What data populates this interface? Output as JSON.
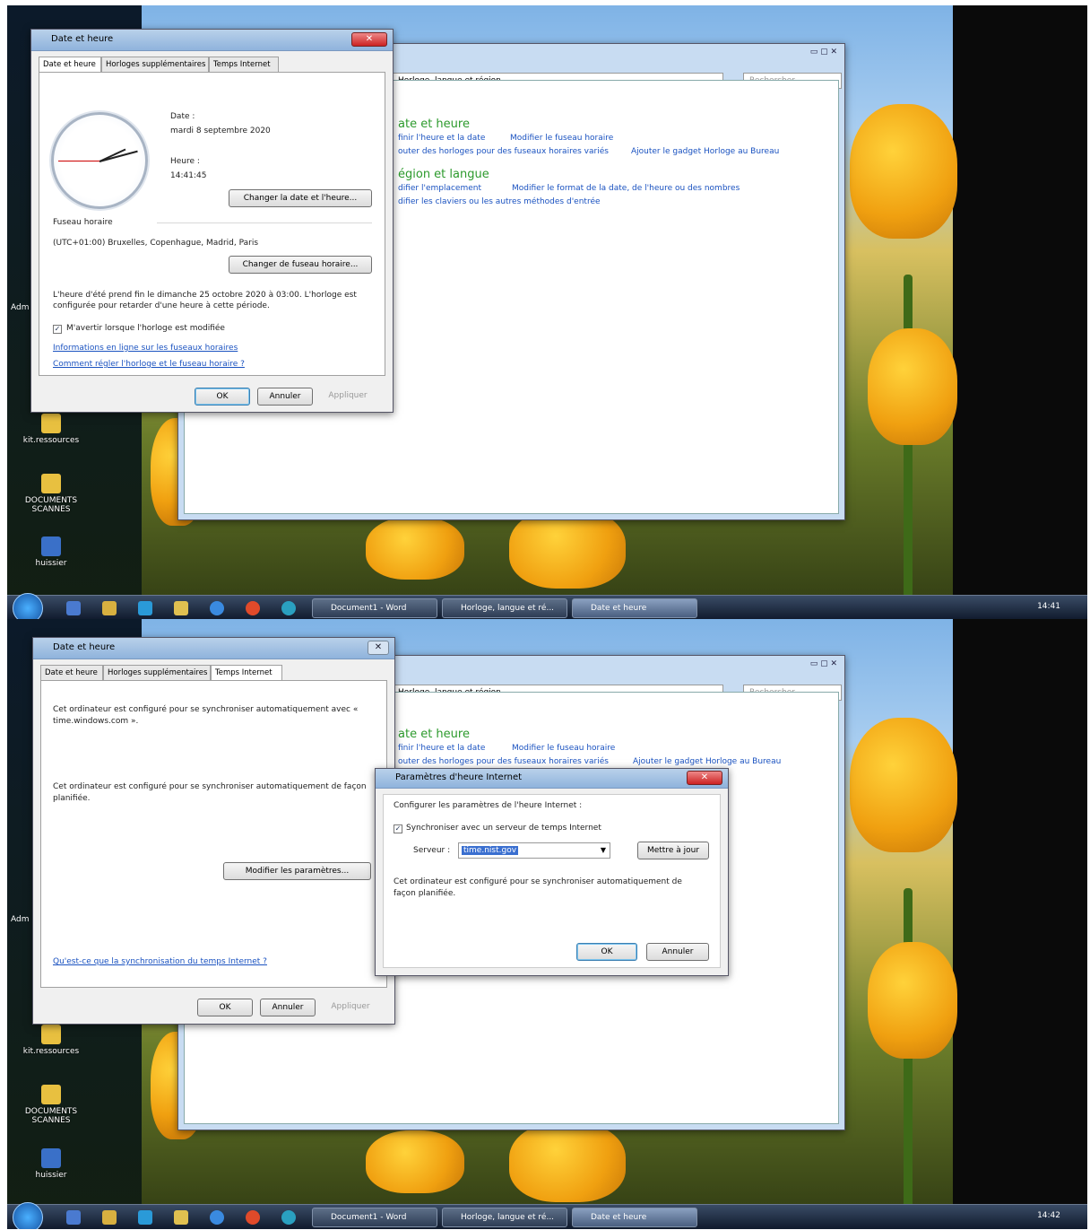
{
  "desktop": {
    "icons": [
      {
        "label": "kit.ressources"
      },
      {
        "label": "DOCUMENTS SCANNES"
      },
      {
        "label": "huissier"
      }
    ],
    "left_label": "Adm"
  },
  "taskbar": {
    "buttons": [
      "Document1 - Word",
      "Horloge, langue et ré...",
      "Date et heure"
    ],
    "time1": "14:41",
    "time2": "14:42"
  },
  "control_panel": {
    "address": "Horloge, langue et région",
    "search_placeholder": "Rechercher",
    "section1_title": "ate et heure",
    "section1_links": [
      "finir l'heure et la date",
      "Modifier le fuseau horaire",
      "outer des horloges pour des fuseaux horaires variés",
      "Ajouter le gadget Horloge au Bureau"
    ],
    "section2_title": "égion et langue",
    "section2_links": [
      "difier l'emplacement",
      "Modifier le format de la date, de l'heure ou des nombres",
      "difier les claviers ou les autres méthodes d'entrée"
    ]
  },
  "dialog1": {
    "title": "Date et heure",
    "tabs": [
      "Date et heure",
      "Horloges supplémentaires",
      "Temps Internet"
    ],
    "date_label": "Date :",
    "date_value": "mardi 8 septembre 2020",
    "time_label": "Heure :",
    "time_value": "14:41:45",
    "change_date_button": "Changer la date et l'heure...",
    "timezone_label": "Fuseau horaire",
    "timezone_value": "(UTC+01:00) Bruxelles, Copenhague, Madrid, Paris",
    "change_tz_button": "Changer de fuseau horaire...",
    "dst_note": "L'heure d'été prend fin le dimanche 25 octobre 2020 à 03:00. L'horloge est configurée pour retarder d'une heure à cette période.",
    "notify_checkbox": "M'avertir lorsque l'horloge est modifiée",
    "link1": "Informations en ligne sur les fuseaux horaires",
    "link2": "Comment régler l'horloge et le fuseau horaire ?",
    "ok": "OK",
    "cancel": "Annuler",
    "apply": "Appliquer"
  },
  "dialog2": {
    "title": "Date et heure",
    "tabs": [
      "Date et heure",
      "Horloges supplémentaires",
      "Temps Internet"
    ],
    "sync_text1": "Cet ordinateur est configuré pour se synchroniser automatiquement avec « time.windows.com ».",
    "sync_text2": "Cet ordinateur est configuré pour se synchroniser automatiquement de façon planifiée.",
    "modify_button": "Modifier les paramètres...",
    "link": "Qu'est-ce que la synchronisation du temps Internet ?",
    "ok": "OK",
    "cancel": "Annuler",
    "apply": "Appliquer"
  },
  "internet_time_dialog": {
    "title": "Paramètres d'heure Internet",
    "heading": "Configurer les paramètres de l'heure Internet :",
    "sync_checkbox": "Synchroniser avec un serveur de temps Internet",
    "server_label": "Serveur :",
    "server_value": "time.nist.gov",
    "update_button": "Mettre à jour",
    "note": "Cet ordinateur est configuré pour se synchroniser automatiquement de façon planifiée.",
    "ok": "OK",
    "cancel": "Annuler"
  }
}
